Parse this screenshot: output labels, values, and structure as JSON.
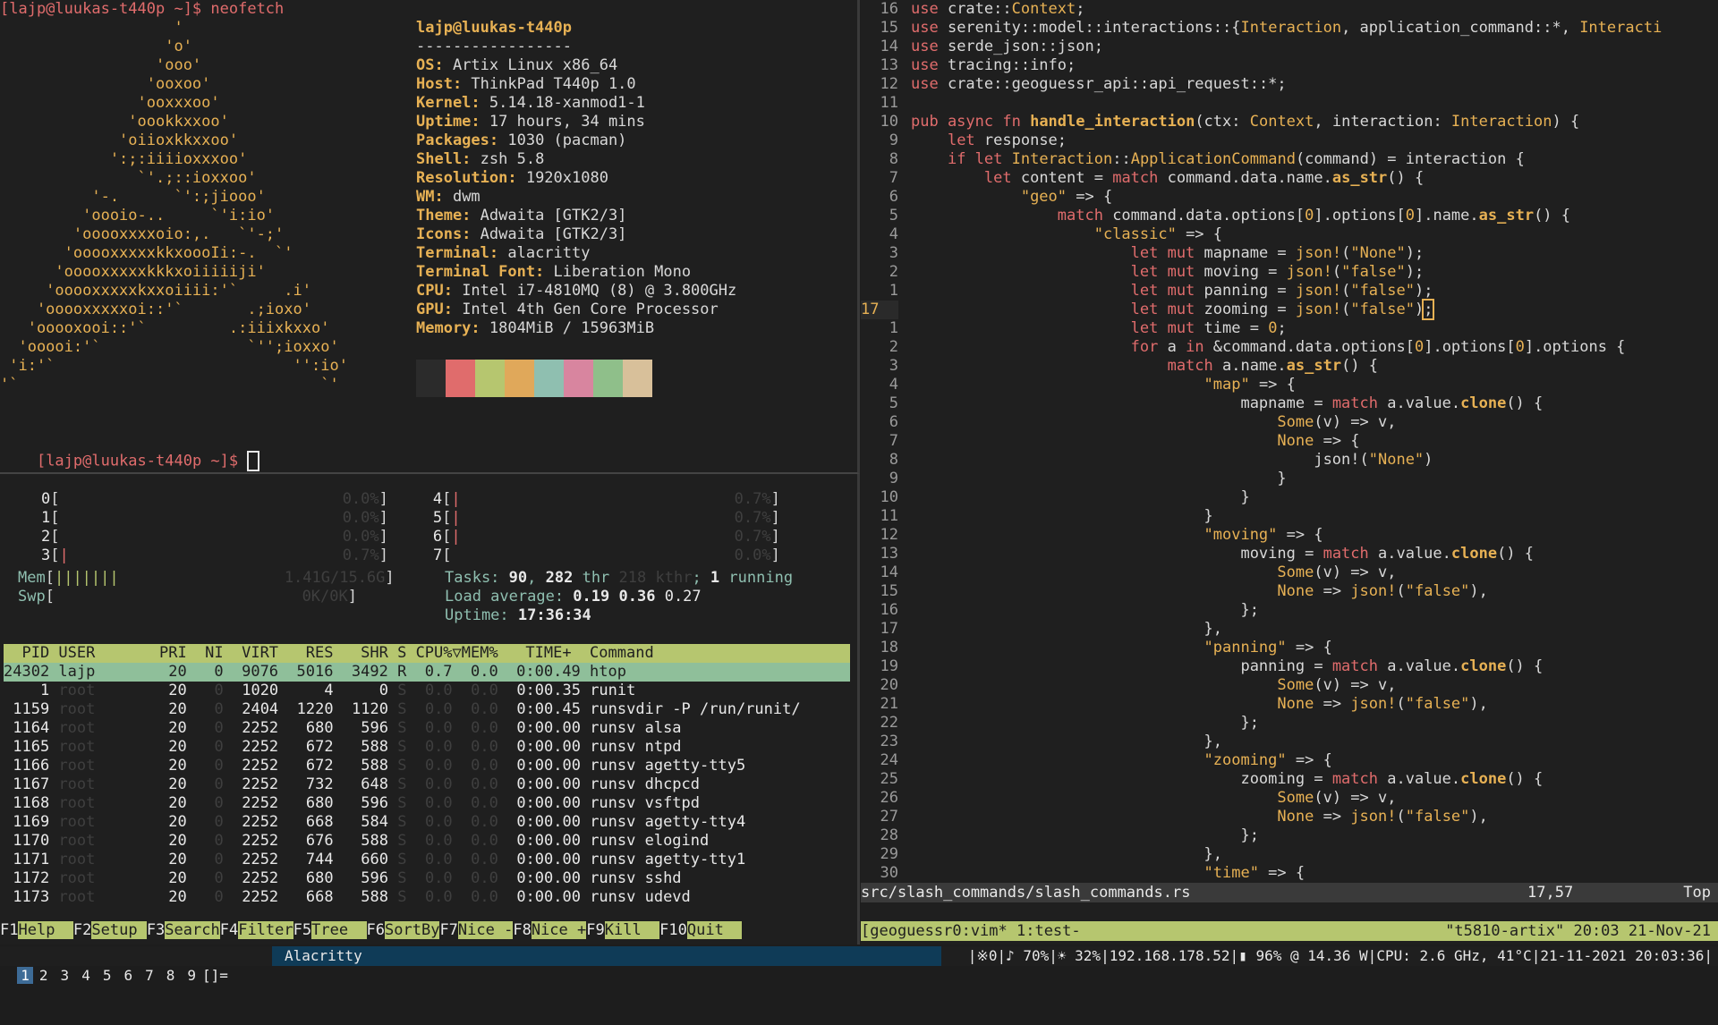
{
  "neofetch": {
    "command_line": "[lajp@luukas-t440p ~]$ neofetch",
    "ascii": [
      "                   '",
      "                  'o'",
      "                 'ooo'",
      "                'ooxoo'",
      "               'ooxxxoo'",
      "              'oookkxxoo'",
      "             'oiioxkkxxoo'",
      "            ':;:iiiioxxxoo'",
      "               `'.;::ioxxoo'",
      "          '-.      `':;jiooo'",
      "         'oooio-..     `'i:io'",
      "        'ooooxxxxoio:,.   `'-;'",
      "       'ooooxxxxxkkxoooIi:-.  `'",
      "      'ooooxxxxxkkkxoiiiiiji'",
      "     'ooooxxxxxkxxoiiii:'`     .i'",
      "    'ooooxxxxxoi::'`       .;ioxo'",
      "   'ooooxooi::'`         .:iiixkxxo'",
      "  'ooooi:'`                `'';ioxxo'",
      " 'i:'`                          '':io'",
      "'`                                 `'"
    ],
    "user_host": "lajp@luukas-t440p",
    "separator": "-----------------",
    "info": [
      {
        "label": "OS",
        "value": "Artix Linux x86_64"
      },
      {
        "label": "Host",
        "value": "ThinkPad T440p 1.0"
      },
      {
        "label": "Kernel",
        "value": "5.14.18-xanmod1-1"
      },
      {
        "label": "Uptime",
        "value": "17 hours, 34 mins"
      },
      {
        "label": "Packages",
        "value": "1030 (pacman)"
      },
      {
        "label": "Shell",
        "value": "zsh 5.8"
      },
      {
        "label": "Resolution",
        "value": "1920x1080"
      },
      {
        "label": "WM",
        "value": "dwm"
      },
      {
        "label": "Theme",
        "value": "Adwaita [GTK2/3]"
      },
      {
        "label": "Icons",
        "value": "Adwaita [GTK2/3]"
      },
      {
        "label": "Terminal",
        "value": "alacritty"
      },
      {
        "label": "Terminal Font",
        "value": "Liberation Mono"
      },
      {
        "label": "CPU",
        "value": "Intel i7-4810MQ (8) @ 3.800GHz"
      },
      {
        "label": "GPU",
        "value": "Intel 4th Gen Core Processor"
      },
      {
        "label": "Memory",
        "value": "1804MiB / 15963MiB"
      }
    ],
    "palette": [
      "#2b2b2b",
      "#e06c6c",
      "#b6c66f",
      "#e0a85a",
      "#8fbfb0",
      "#d8859f",
      "#8fbf8a",
      "#d8c09a"
    ],
    "prompt_line": "[lajp@luukas-t440p ~]$ "
  },
  "htop": {
    "cpus_left": [
      {
        "id": "0",
        "bar": "",
        "pct": "0.0%"
      },
      {
        "id": "1",
        "bar": "",
        "pct": "0.0%"
      },
      {
        "id": "2",
        "bar": "",
        "pct": "0.0%"
      },
      {
        "id": "3",
        "bar": "|",
        "pct": "0.7%"
      }
    ],
    "cpus_right": [
      {
        "id": "4",
        "bar": "|",
        "pct": "0.7%"
      },
      {
        "id": "5",
        "bar": "|",
        "pct": "0.7%"
      },
      {
        "id": "6",
        "bar": "|",
        "pct": "0.7%"
      },
      {
        "id": "7",
        "bar": "",
        "pct": "0.0%"
      }
    ],
    "mem": {
      "label": "Mem",
      "bar": "|||||||",
      "value": "1.41G/15.6G"
    },
    "swp": {
      "label": "Swp",
      "bar": "",
      "value": "0K/0K"
    },
    "tasks_label": "Tasks: ",
    "tasks": "90",
    "thr": "282",
    "kthr": "218",
    "running": "1",
    "load_label": "Load average: ",
    "load1": "0.19",
    "load5": "0.36",
    "load15": "0.27",
    "uptime_label": "Uptime: ",
    "uptime": "17:36:34",
    "header": "  PID USER       PRI  NI  VIRT   RES   SHR S CPU%▽MEM%   TIME+  Command",
    "selected": "24302 lajp        20   0  9076  5016  3492 R  0.7  0.0  0:00.49 htop",
    "procs": [
      {
        "pid": "1",
        "user": "root",
        "pri": "20",
        "ni": "0",
        "virt": "1020",
        "res": "4",
        "shr": "0",
        "s": "S",
        "cpu": "0.0",
        "mem": "0.0",
        "time": "0:00.35",
        "cmd": "runit"
      },
      {
        "pid": "1159",
        "user": "root",
        "pri": "20",
        "ni": "0",
        "virt": "2404",
        "res": "1220",
        "shr": "1120",
        "s": "S",
        "cpu": "0.0",
        "mem": "0.0",
        "time": "0:00.45",
        "cmd": "runsvdir -P /run/runit/"
      },
      {
        "pid": "1164",
        "user": "root",
        "pri": "20",
        "ni": "0",
        "virt": "2252",
        "res": "680",
        "shr": "596",
        "s": "S",
        "cpu": "0.0",
        "mem": "0.0",
        "time": "0:00.00",
        "cmd": "runsv alsa"
      },
      {
        "pid": "1165",
        "user": "root",
        "pri": "20",
        "ni": "0",
        "virt": "2252",
        "res": "672",
        "shr": "588",
        "s": "S",
        "cpu": "0.0",
        "mem": "0.0",
        "time": "0:00.00",
        "cmd": "runsv ntpd"
      },
      {
        "pid": "1166",
        "user": "root",
        "pri": "20",
        "ni": "0",
        "virt": "2252",
        "res": "672",
        "shr": "588",
        "s": "S",
        "cpu": "0.0",
        "mem": "0.0",
        "time": "0:00.00",
        "cmd": "runsv agetty-tty5"
      },
      {
        "pid": "1167",
        "user": "root",
        "pri": "20",
        "ni": "0",
        "virt": "2252",
        "res": "732",
        "shr": "648",
        "s": "S",
        "cpu": "0.0",
        "mem": "0.0",
        "time": "0:00.00",
        "cmd": "runsv dhcpcd"
      },
      {
        "pid": "1168",
        "user": "root",
        "pri": "20",
        "ni": "0",
        "virt": "2252",
        "res": "680",
        "shr": "596",
        "s": "S",
        "cpu": "0.0",
        "mem": "0.0",
        "time": "0:00.00",
        "cmd": "runsv vsftpd"
      },
      {
        "pid": "1169",
        "user": "root",
        "pri": "20",
        "ni": "0",
        "virt": "2252",
        "res": "668",
        "shr": "584",
        "s": "S",
        "cpu": "0.0",
        "mem": "0.0",
        "time": "0:00.00",
        "cmd": "runsv agetty-tty4"
      },
      {
        "pid": "1170",
        "user": "root",
        "pri": "20",
        "ni": "0",
        "virt": "2252",
        "res": "676",
        "shr": "588",
        "s": "S",
        "cpu": "0.0",
        "mem": "0.0",
        "time": "0:00.00",
        "cmd": "runsv elogind"
      },
      {
        "pid": "1171",
        "user": "root",
        "pri": "20",
        "ni": "0",
        "virt": "2252",
        "res": "744",
        "shr": "660",
        "s": "S",
        "cpu": "0.0",
        "mem": "0.0",
        "time": "0:00.00",
        "cmd": "runsv agetty-tty1"
      },
      {
        "pid": "1172",
        "user": "root",
        "pri": "20",
        "ni": "0",
        "virt": "2252",
        "res": "680",
        "shr": "596",
        "s": "S",
        "cpu": "0.0",
        "mem": "0.0",
        "time": "0:00.00",
        "cmd": "runsv sshd"
      },
      {
        "pid": "1173",
        "user": "root",
        "pri": "20",
        "ni": "0",
        "virt": "2252",
        "res": "668",
        "shr": "588",
        "s": "S",
        "cpu": "0.0",
        "mem": "0.0",
        "time": "0:00.00",
        "cmd": "runsv udevd"
      }
    ],
    "fkeys": [
      {
        "key": "F1",
        "label": "Help  "
      },
      {
        "key": "F2",
        "label": "Setup "
      },
      {
        "key": "F3",
        "label": "Search"
      },
      {
        "key": "F4",
        "label": "Filter"
      },
      {
        "key": "F5",
        "label": "Tree  "
      },
      {
        "key": "F6",
        "label": "SortBy"
      },
      {
        "key": "F7",
        "label": "Nice -"
      },
      {
        "key": "F8",
        "label": "Nice +"
      },
      {
        "key": "F9",
        "label": "Kill  "
      },
      {
        "key": "F10",
        "label": "Quit  "
      }
    ]
  },
  "vim": {
    "lines": [
      {
        "n": "16",
        "h": "<span class='kw'>use</span> crate::<span class='ty'>Context</span>;"
      },
      {
        "n": "15",
        "h": "<span class='kw'>use</span> serenity::model::interactions::{<span class='ty'>Interaction</span>, application_command::*, <span class='ty'>Interacti</span>"
      },
      {
        "n": "14",
        "h": "<span class='kw'>use</span> serde_json::json;"
      },
      {
        "n": "13",
        "h": "<span class='kw'>use</span> tracing::info;"
      },
      {
        "n": "12",
        "h": "<span class='kw'>use</span> crate::geoguessr_api::api_request::*;"
      },
      {
        "n": "11",
        "h": ""
      },
      {
        "n": "10",
        "h": "<span class='kw'>pub async fn</span> <span class='fn'>handle_interaction</span>(ctx: <span class='ty'>Context</span>, interaction: <span class='ty'>Interaction</span>) {"
      },
      {
        "n": "9",
        "h": "    <span class='kw'>let</span> response;"
      },
      {
        "n": "8",
        "h": "    <span class='kw'>if let</span> <span class='ty'>Interaction</span>::<span class='ty'>ApplicationCommand</span>(command) = interaction {"
      },
      {
        "n": "7",
        "h": "        <span class='kw'>let</span> content = <span class='kw'>match</span> command.data.name.<span class='fn'>as_str</span>() {"
      },
      {
        "n": "6",
        "h": "            <span class='str'>\"geo\"</span> => {"
      },
      {
        "n": "5",
        "h": "                <span class='kw'>match</span> command.data.options[<span class='str'>0</span>].options[<span class='str'>0</span>].name.<span class='fn'>as_str</span>() {"
      },
      {
        "n": "4",
        "h": "                    <span class='str'>\"classic\"</span> => {"
      },
      {
        "n": "3",
        "h": "                        <span class='kw'>let mut</span> mapname = <span class='mac'>json!</span>(<span class='str'>\"None\"</span>);"
      },
      {
        "n": "2",
        "h": "                        <span class='kw'>let mut</span> moving = <span class='mac'>json!</span>(<span class='str'>\"false\"</span>);"
      },
      {
        "n": "1",
        "h": "                        <span class='kw'>let mut</span> panning = <span class='mac'>json!</span>(<span class='str'>\"false\"</span>);"
      },
      {
        "n": "17",
        "cur": true,
        "h": "                        <span class='kw'>let mut</span> zooming = <span class='mac'>json!</span>(<span class='str'>\"false\"</span>)<span class='cursor-box'>;</span>"
      },
      {
        "n": "1",
        "h": "                        <span class='kw'>let mut</span> time = <span class='str'>0</span>;"
      },
      {
        "n": "2",
        "h": "                        <span class='kw'>for</span> a <span class='kw'>in</span> &command.data.options[<span class='str'>0</span>].options[<span class='str'>0</span>].options {"
      },
      {
        "n": "3",
        "h": "                            <span class='kw'>match</span> a.name.<span class='fn'>as_str</span>() {"
      },
      {
        "n": "4",
        "h": "                                <span class='str'>\"map\"</span> => {"
      },
      {
        "n": "5",
        "h": "                                    mapname = <span class='kw'>match</span> a.value.<span class='fn'>clone</span>() {"
      },
      {
        "n": "6",
        "h": "                                        <span class='ty'>Some</span>(v) => v,"
      },
      {
        "n": "7",
        "h": "                                        <span class='ty'>None</span> => {"
      },
      {
        "n": "8",
        "h": "                                            json!(<span class='str'>\"None\"</span>)"
      },
      {
        "n": "9",
        "h": "                                        }"
      },
      {
        "n": "10",
        "h": "                                    }"
      },
      {
        "n": "11",
        "h": "                                }"
      },
      {
        "n": "12",
        "h": "                                <span class='str'>\"moving\"</span> => {"
      },
      {
        "n": "13",
        "h": "                                    moving = <span class='kw'>match</span> a.value.<span class='fn'>clone</span>() {"
      },
      {
        "n": "14",
        "h": "                                        <span class='ty'>Some</span>(v) => v,"
      },
      {
        "n": "15",
        "h": "                                        <span class='ty'>None</span> => <span class='mac'>json!</span>(<span class='str'>\"false\"</span>),"
      },
      {
        "n": "16",
        "h": "                                    };"
      },
      {
        "n": "17",
        "h": "                                },"
      },
      {
        "n": "18",
        "h": "                                <span class='str'>\"panning\"</span> => {"
      },
      {
        "n": "19",
        "h": "                                    panning = <span class='kw'>match</span> a.value.<span class='fn'>clone</span>() {"
      },
      {
        "n": "20",
        "h": "                                        <span class='ty'>Some</span>(v) => v,"
      },
      {
        "n": "21",
        "h": "                                        <span class='ty'>None</span> => <span class='mac'>json!</span>(<span class='str'>\"false\"</span>),"
      },
      {
        "n": "22",
        "h": "                                    };"
      },
      {
        "n": "23",
        "h": "                                },"
      },
      {
        "n": "24",
        "h": "                                <span class='str'>\"zooming\"</span> => {"
      },
      {
        "n": "25",
        "h": "                                    zooming = <span class='kw'>match</span> a.value.<span class='fn'>clone</span>() {"
      },
      {
        "n": "26",
        "h": "                                        <span class='ty'>Some</span>(v) => v,"
      },
      {
        "n": "27",
        "h": "                                        <span class='ty'>None</span> => <span class='mac'>json!</span>(<span class='str'>\"false\"</span>),"
      },
      {
        "n": "28",
        "h": "                                    };"
      },
      {
        "n": "29",
        "h": "                                },"
      },
      {
        "n": "30",
        "h": "                                <span class='str'>\"time\"</span> => {"
      }
    ],
    "status_file": "src/slash_commands/slash_commands.rs",
    "status_pos": "17,57",
    "status_scroll": "Top",
    "tmux_left": "[geoguessr0:vim* 1:test-",
    "tmux_right": "\"t5810-artix\" 20:03 21-Nov-21"
  },
  "dwm": {
    "tags": [
      "1",
      "2",
      "3",
      "4",
      "5",
      "6",
      "7",
      "8",
      "9"
    ],
    "layout": "[]=",
    "window_title": "Alacritty",
    "status": "|※0|♪ 70%|☀ 32%|192.168.178.52|▮ 96% @ 14.36 W|CPU: 2.6 GHz, 41°C|21-11-2021 20:03:36|"
  }
}
